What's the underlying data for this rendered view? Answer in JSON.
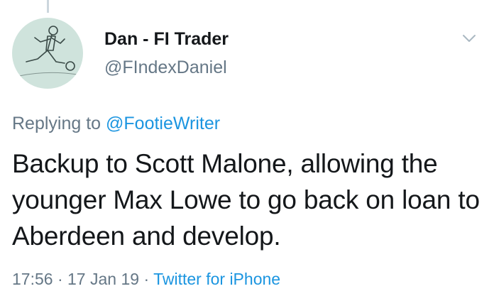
{
  "tweet": {
    "author": {
      "display_name": "Dan - FI Trader",
      "handle": "@FIndexDaniel",
      "avatar_icon": "footballer-kicking-icon"
    },
    "reply": {
      "prefix": "Replying to",
      "mention": "@FootieWriter"
    },
    "text": "Backup to Scott Malone, allowing the younger Max Lowe to go back on loan to Aberdeen and develop.",
    "meta": {
      "time": "17:56",
      "separator": "·",
      "date": "17 Jan 19",
      "source": "Twitter for iPhone"
    },
    "menu_icon": "chevron-down-icon"
  },
  "colors": {
    "link": "#1b95e0",
    "secondary_text": "#657786",
    "primary_text": "#14171a",
    "thread_line": "#ccd6dd",
    "avatar_bg": "#cfe3dc"
  }
}
